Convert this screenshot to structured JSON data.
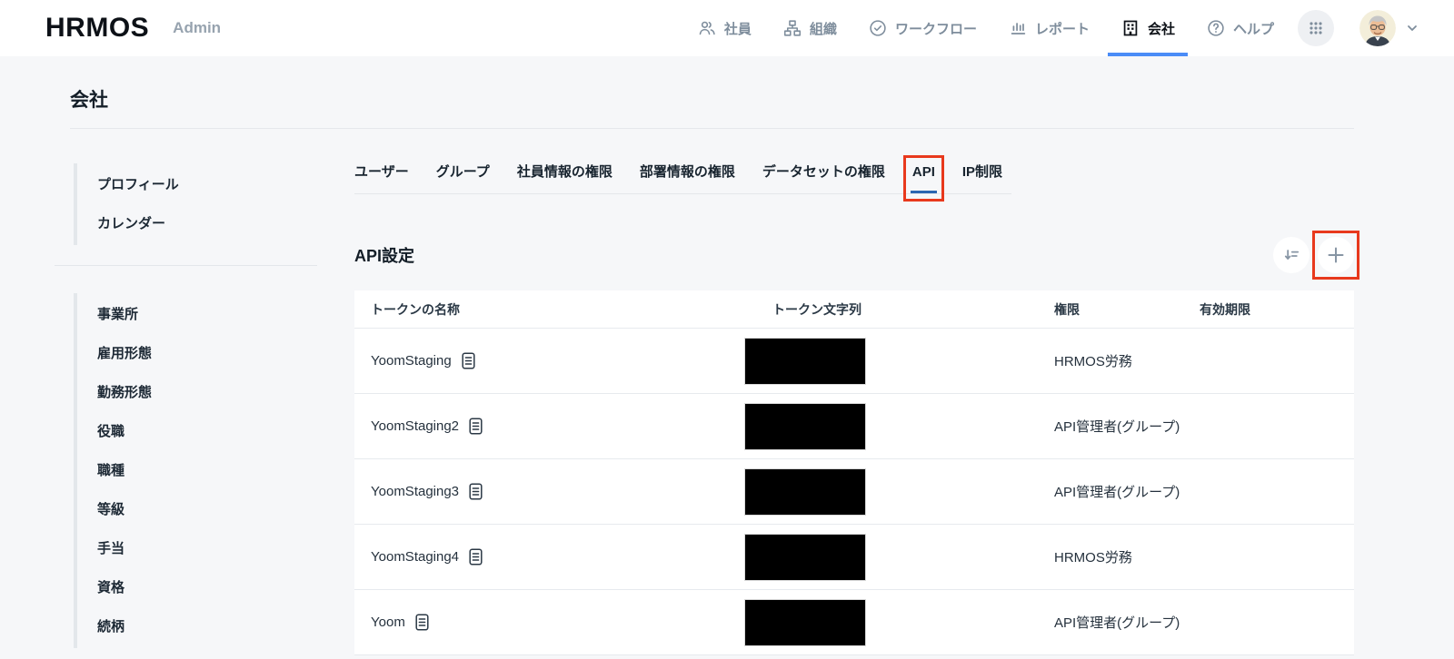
{
  "header": {
    "logo_text": "HRMOS",
    "admin_label": "Admin",
    "nav_items": [
      {
        "label": "社員",
        "icon": "people-icon",
        "active": false
      },
      {
        "label": "組織",
        "icon": "org-chart-icon",
        "active": false
      },
      {
        "label": "ワークフロー",
        "icon": "check-circle-icon",
        "active": false
      },
      {
        "label": "レポート",
        "icon": "bar-chart-icon",
        "active": false
      },
      {
        "label": "会社",
        "icon": "building-icon",
        "active": true
      },
      {
        "label": "ヘルプ",
        "icon": "help-circle-icon",
        "active": false
      }
    ]
  },
  "page": {
    "title": "会社"
  },
  "sidebar": {
    "group1": [
      {
        "label": "プロフィール"
      },
      {
        "label": "カレンダー"
      }
    ],
    "group2": [
      {
        "label": "事業所"
      },
      {
        "label": "雇用形態"
      },
      {
        "label": "勤務形態"
      },
      {
        "label": "役職"
      },
      {
        "label": "職種"
      },
      {
        "label": "等級"
      },
      {
        "label": "手当"
      },
      {
        "label": "資格"
      },
      {
        "label": "続柄"
      }
    ]
  },
  "tabs": {
    "items": [
      {
        "label": "ユーザー",
        "active": false
      },
      {
        "label": "グループ",
        "active": false
      },
      {
        "label": "社員情報の権限",
        "active": false
      },
      {
        "label": "部署情報の権限",
        "active": false
      },
      {
        "label": "データセットの権限",
        "active": false
      },
      {
        "label": "API",
        "active": true,
        "annotated": true
      },
      {
        "label": "IP制限",
        "active": false
      }
    ]
  },
  "section": {
    "title": "API設定"
  },
  "table": {
    "columns": [
      "トークンの名称",
      "トークン文字列",
      "権限",
      "有効期限"
    ],
    "rows": [
      {
        "name": "YoomStaging",
        "token_redacted": true,
        "permission": "HRMOS労務",
        "expiry": ""
      },
      {
        "name": "YoomStaging2",
        "token_redacted": true,
        "permission": "API管理者(グループ)",
        "expiry": ""
      },
      {
        "name": "YoomStaging3",
        "token_redacted": true,
        "permission": "API管理者(グループ)",
        "expiry": ""
      },
      {
        "name": "YoomStaging4",
        "token_redacted": true,
        "permission": "HRMOS労務",
        "expiry": ""
      },
      {
        "name": "Yoom",
        "token_redacted": true,
        "permission": "API管理者(グループ)",
        "expiry": ""
      }
    ]
  },
  "annotations": {
    "highlight_color": "#e8391d",
    "highlighted_elements": [
      "tab-api",
      "add-token-button"
    ]
  },
  "colors": {
    "nav_active_underline": "#4a8cf7",
    "tab_active_underline": "#2b66b1",
    "nav_inactive": "#7e8d9c",
    "page_background": "#f6f7f9"
  }
}
